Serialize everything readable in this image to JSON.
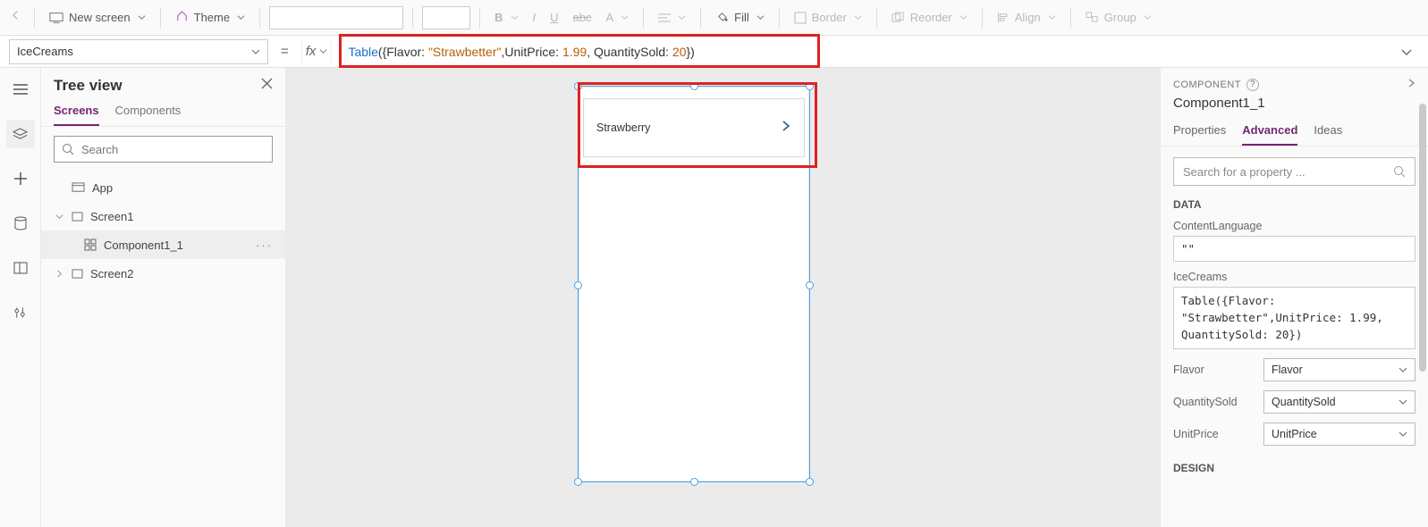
{
  "ribbon": {
    "new_screen": "New screen",
    "theme": "Theme",
    "fill": "Fill",
    "border": "Border",
    "reorder": "Reorder",
    "align": "Align",
    "group": "Group"
  },
  "formula": {
    "property": "IceCreams",
    "fx": "fx",
    "tokens": {
      "func": "Table",
      "k1": "Flavor",
      "v1": "\"Strawbetter\"",
      "k2": "UnitPrice",
      "v2": "1.99",
      "k3": "QuantitySold",
      "v3": "20"
    }
  },
  "tree": {
    "title": "Tree view",
    "tabs": {
      "screens": "Screens",
      "components": "Components"
    },
    "search_placeholder": "Search",
    "items": {
      "app": "App",
      "screen1": "Screen1",
      "component": "Component1_1",
      "screen2": "Screen2"
    }
  },
  "canvas": {
    "gallery_item_text": "Strawberry"
  },
  "right": {
    "header": "COMPONENT",
    "name": "Component1_1",
    "tabs": {
      "properties": "Properties",
      "advanced": "Advanced",
      "ideas": "Ideas"
    },
    "search_placeholder": "Search for a property ...",
    "section_data": "DATA",
    "labels": {
      "contentlanguage": "ContentLanguage",
      "icecreams": "IceCreams",
      "flavor": "Flavor",
      "quantitysold": "QuantitySold",
      "unitprice": "UnitPrice"
    },
    "values": {
      "contentlanguage": "\"\"",
      "icecreams": "Table({Flavor: \"Strawbetter\",UnitPrice: 1.99, QuantitySold: 20})",
      "flavor": "Flavor",
      "quantitysold": "QuantitySold",
      "unitprice": "UnitPrice"
    },
    "section_design": "DESIGN"
  }
}
